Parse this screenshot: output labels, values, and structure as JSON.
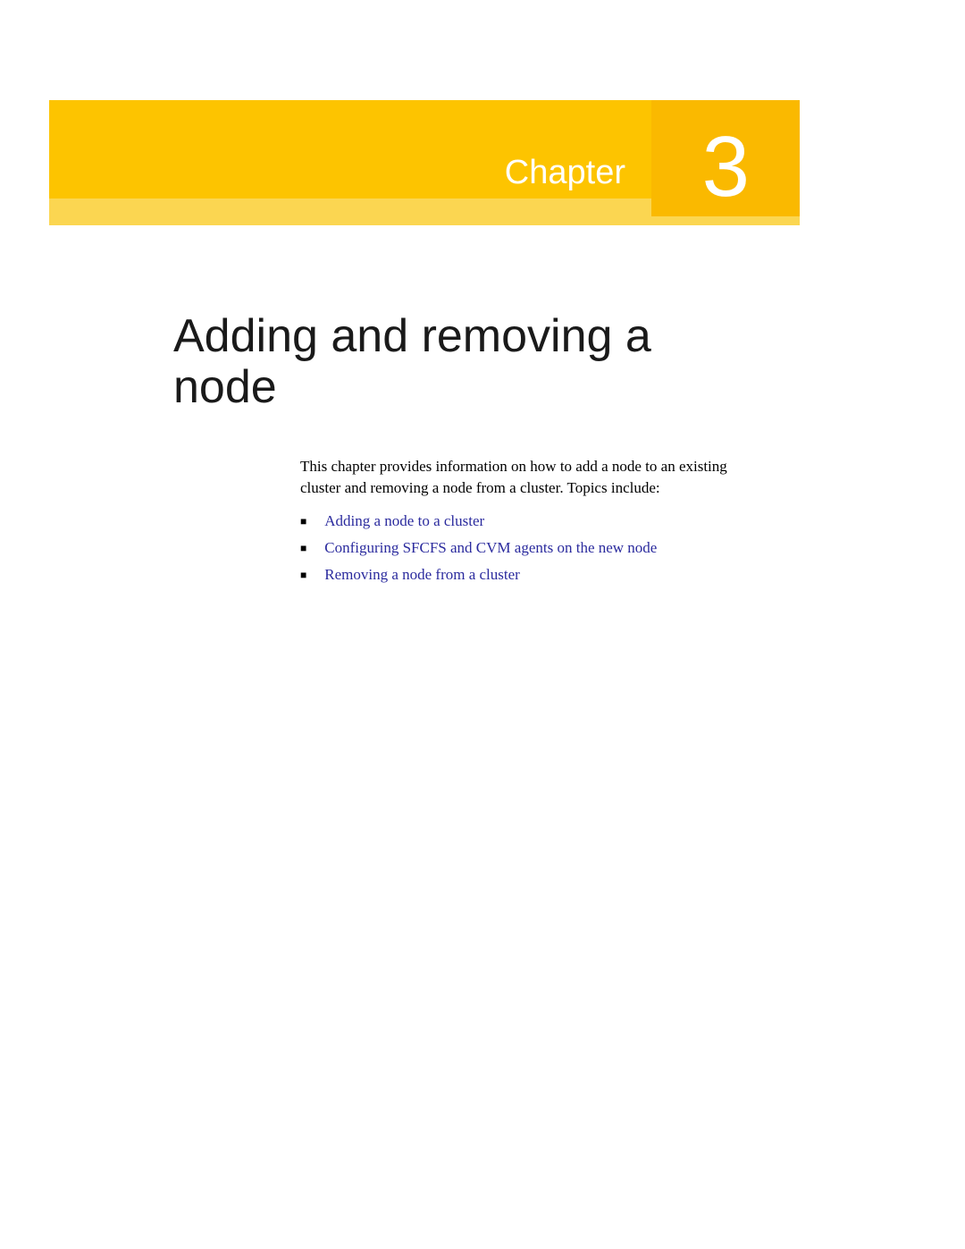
{
  "banner": {
    "label": "Chapter",
    "number": "3"
  },
  "title": "Adding and removing a node",
  "intro": "This chapter provides information on how to add a node to an existing cluster and removing a node from a cluster. Topics include:",
  "topics": [
    "Adding a node to a cluster",
    "Configuring SFCFS and CVM agents on the new node",
    "Removing a node from a cluster"
  ],
  "colors": {
    "bannerMain": "#fdc400",
    "bannerLight": "#fbd651",
    "bannerDark": "#fab900",
    "link": "#2b2b9e"
  }
}
